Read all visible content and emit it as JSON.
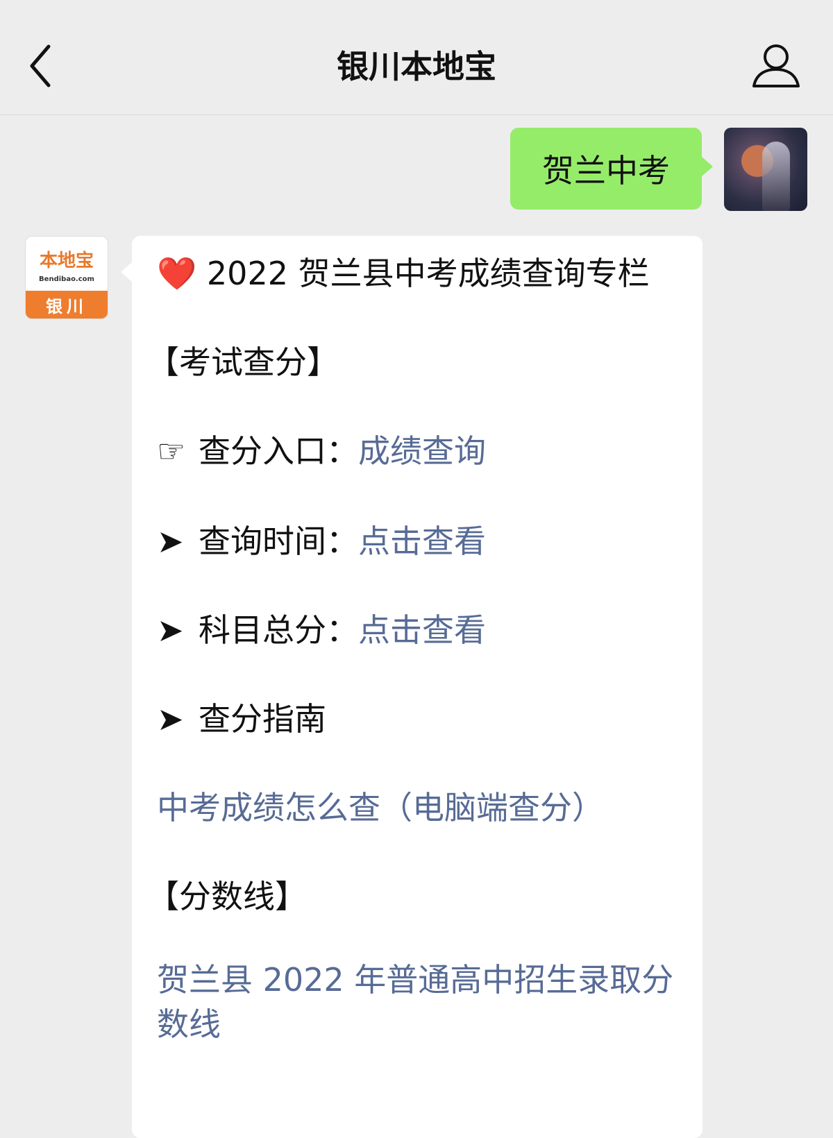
{
  "header": {
    "title": "银川本地宝",
    "back_icon": "chevron-left-icon",
    "profile_icon": "person-icon"
  },
  "user_message": {
    "text": "贺兰中考"
  },
  "bot": {
    "avatar": {
      "logo_text": "本地宝",
      "logo_sub": "Bendibao.com",
      "city": "银川"
    },
    "title_emoji": "❤️",
    "title": "2022 贺兰县中考成绩查询专栏",
    "section1": "【考试查分】",
    "entry": {
      "symbol": "☞",
      "label": "查分入口：",
      "link": "成绩查询"
    },
    "time": {
      "symbol": "➤",
      "label": "查询时间：",
      "link": "点击查看"
    },
    "score": {
      "symbol": "➤",
      "label": "科目总分：",
      "link": "点击查看"
    },
    "guide": {
      "symbol": "➤",
      "label": "查分指南"
    },
    "guide_link": "中考成绩怎么查（电脑端查分）",
    "section2": "【分数线】",
    "cutoff_link": "贺兰县 2022 年普通高中招生录取分数线"
  },
  "colors": {
    "user_bubble": "#95ec69",
    "link": "#576b95",
    "brand_orange": "#ef7d2e"
  }
}
